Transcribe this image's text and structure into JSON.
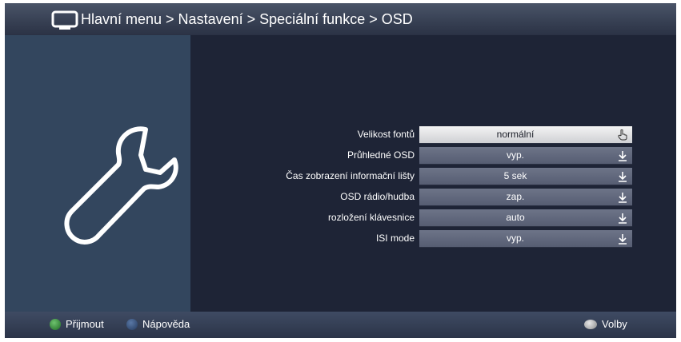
{
  "header": {
    "breadcrumb": "Hlavní menu > Nastavení > Speciální funkce > OSD"
  },
  "settings": [
    {
      "label": "Velikost fontů",
      "value": "normální",
      "selected": true
    },
    {
      "label": "Průhledné OSD",
      "value": "vyp.",
      "selected": false
    },
    {
      "label": "Čas zobrazení informační lišty",
      "value": "5 sek",
      "selected": false
    },
    {
      "label": "OSD rádio/hudba",
      "value": "zap.",
      "selected": false
    },
    {
      "label": "rozložení klávesnice",
      "value": "auto",
      "selected": false
    },
    {
      "label": "ISI mode",
      "value": "vyp.",
      "selected": false
    }
  ],
  "footer": {
    "accept_label": "Přijmout",
    "help_label": "Nápověda",
    "options_label": "Volby"
  },
  "colors": {
    "background": "#1e2436",
    "sidebar": "#33465e",
    "selected_row": "#e8e8ea",
    "row": "#626a7e"
  },
  "icons": [
    "tv-icon",
    "wrench-icon",
    "hand-pointer-icon",
    "dropdown-arrow-icon"
  ]
}
